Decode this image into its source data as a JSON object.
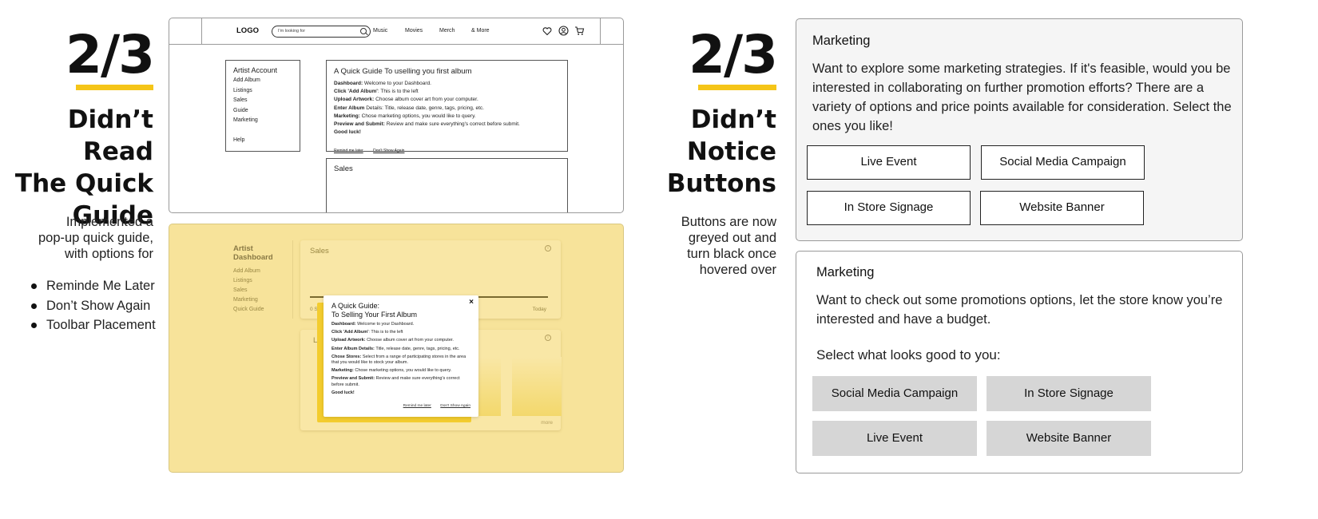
{
  "left_panel": {
    "count": "2/3",
    "headline": [
      "Didn’t Read",
      "The Quick",
      "Guide"
    ],
    "description": [
      "Implemented a",
      "pop-up quick guide,",
      "with options for"
    ],
    "bullets": [
      "Reminde Me Later",
      "Don’t Show Again",
      "Toolbar Placement"
    ]
  },
  "wireframe": {
    "logo": "LOGO",
    "search_placeholder": "I'm looking for",
    "nav": [
      "Music",
      "Movies",
      "Merch",
      "& More"
    ],
    "icons": [
      "heart-icon",
      "user-icon",
      "cart-icon"
    ],
    "menu": {
      "title": "Artist Account",
      "items": [
        "Add Album",
        "Listings",
        "Sales",
        "Guide",
        "Marketing"
      ],
      "help": "Help"
    },
    "guide": {
      "title": "A Quick Guide To uselling you first album",
      "lines": [
        {
          "bold": "Dashboard:",
          "text": " Welcome to your Dashboard."
        },
        {
          "bold": "Click 'Add Album'",
          "text": ": This is to the left"
        },
        {
          "bold": "Upload Artwork:",
          "text": " Choose album cover art from your computer."
        },
        {
          "bold": "Enter Album",
          "text": " Details: Title, release date, genre, tags, pricing, etc."
        },
        {
          "bold": "Marketing:",
          "text": " Chose marketing options, you would like to query."
        },
        {
          "bold": "Preview and Submit:",
          "text": " Review and make sure everything's correct before submit."
        },
        {
          "bold": "Good luck!",
          "text": ""
        }
      ],
      "remind": "Remind me later",
      "dont_show": "Don't Show Again"
    },
    "sales_title": "Sales"
  },
  "yellow_mockup": {
    "dashboard_title": [
      "Artist",
      "Dashboard"
    ],
    "menu": [
      "Add Album",
      "Listings",
      "Sales",
      "Marketing",
      "Quick Guide"
    ],
    "sales_title": "Sales",
    "axis_left": "0 S",
    "axis_right": "Today",
    "second_card_letter": "L",
    "more": "more",
    "modal": {
      "close": "×",
      "title": [
        "A Quick Guide:",
        "To Selling Your First Album"
      ],
      "lines": [
        {
          "bold": "Dashboard:",
          "text": " Welcome to your Dashboard."
        },
        {
          "bold": "Click 'Add Album'",
          "text": ": This is to the left"
        },
        {
          "bold": "Upload Artwork:",
          "text": " Choose album cover art from your computer."
        },
        {
          "bold": "Enter Album Details:",
          "text": " Title, release date, genre, tags, pricing, etc."
        },
        {
          "bold": "Chose Stores:",
          "text": " Select from a range of participating stores in the area that you would like to stock your album."
        },
        {
          "bold": "Marketing:",
          "text": " Chose marketing options, you would like to query."
        },
        {
          "bold": "Preview and Submit:",
          "text": " Review and make sure everything's correct before submit."
        },
        {
          "bold": "Good luck!",
          "text": ""
        }
      ],
      "remind": "Remind me later",
      "dont_show": "Don't Show Again"
    },
    "colors": {
      "panel": "#f7e39a",
      "modal_back": "#f3cc2e",
      "accent_text": "#9a8844"
    }
  },
  "right_panel": {
    "count": "2/3",
    "headline": [
      "Didn’t",
      "Notice",
      "Buttons"
    ],
    "description": [
      "Buttons are now",
      "greyed out and",
      "turn black once",
      "hovered over"
    ]
  },
  "marketing_old": {
    "title": "Marketing",
    "text": "Want to explore some marketing strategies. If it's feasible, would you be interested in collaborating on further promotion efforts? There are a variety of options and price points available for consideration. Select the ones you like!",
    "buttons": [
      "Live Event",
      "Social Media Campaign",
      "In Store Signage",
      "Website Banner"
    ]
  },
  "marketing_new": {
    "title": "Marketing",
    "text": "Want to check out some promotions options, let the store know you’re interested and have a budget.",
    "prompt": "Select what looks good to you:",
    "buttons": [
      "Social Media Campaign",
      "In Store Signage",
      "Live Event",
      "Website Banner"
    ]
  },
  "colors": {
    "accent_yellow": "#f5c518",
    "button_grey": "#d6d6d6"
  }
}
